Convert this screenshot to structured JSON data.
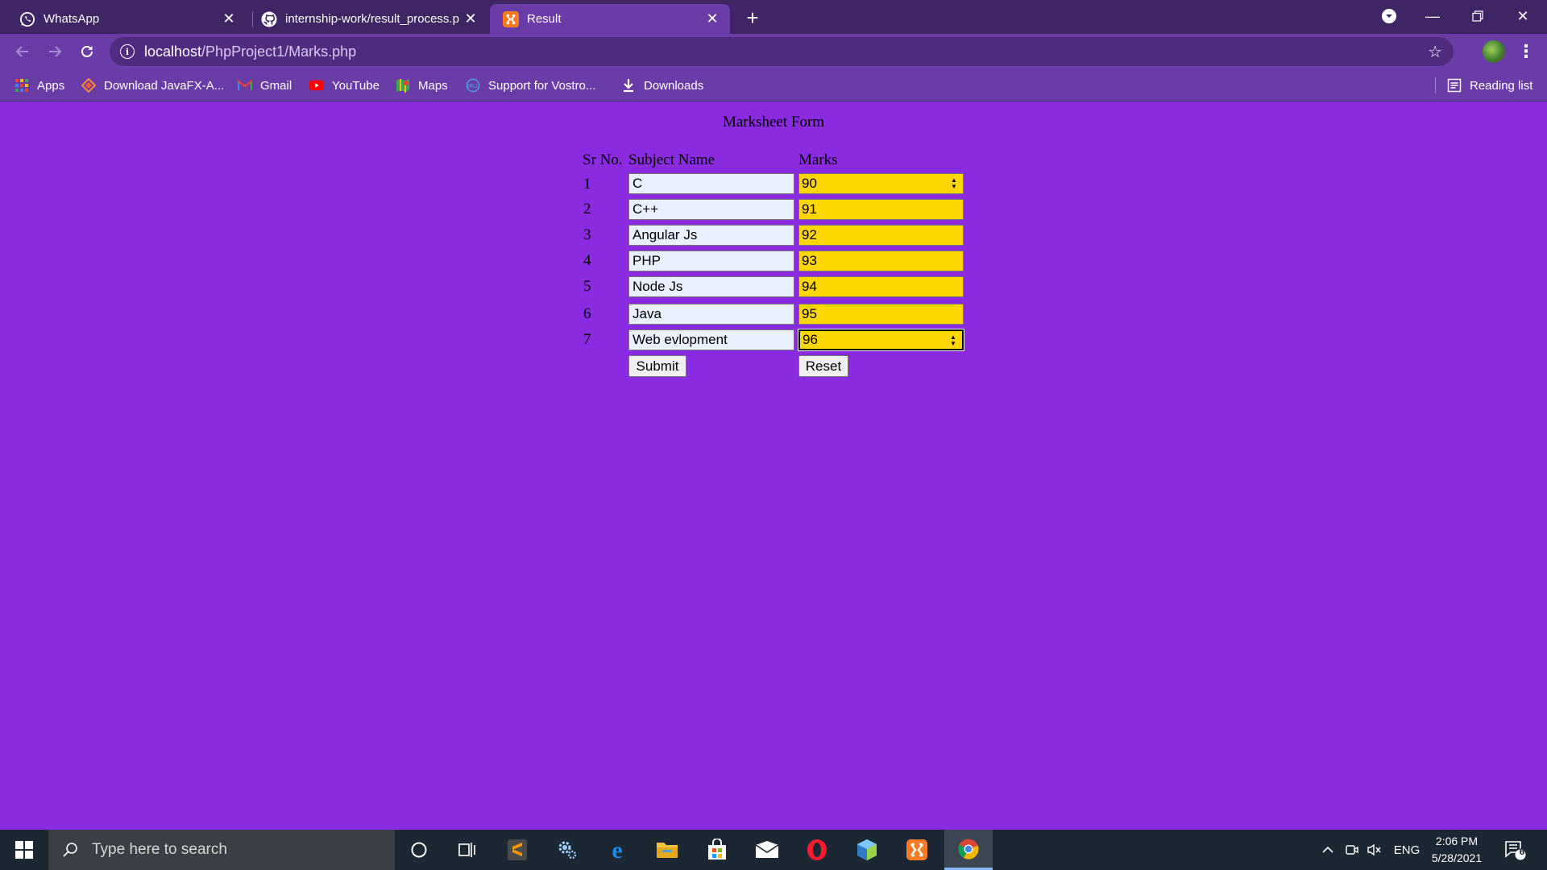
{
  "browser": {
    "tabs": [
      {
        "title": "WhatsApp",
        "icon": "whatsapp-icon"
      },
      {
        "title": "internship-work/result_process.p",
        "icon": "github-icon"
      },
      {
        "title": "Result",
        "icon": "xampp-icon"
      }
    ],
    "url_host": "localhost",
    "url_path": "/PhpProject1/Marks.php",
    "bookmarks": [
      {
        "label": "Apps",
        "icon": "apps-grid-icon"
      },
      {
        "label": "Download JavaFX-A...",
        "icon": "javafx-icon"
      },
      {
        "label": "Gmail",
        "icon": "gmail-icon"
      },
      {
        "label": "YouTube",
        "icon": "youtube-icon"
      },
      {
        "label": "Maps",
        "icon": "maps-icon"
      },
      {
        "label": "Support for Vostro...",
        "icon": "dell-icon"
      },
      {
        "label": "Downloads",
        "icon": "download-icon"
      }
    ],
    "reading_list": "Reading list"
  },
  "form": {
    "title": "Marksheet Form",
    "headers": {
      "srno": "Sr No.",
      "subject": "Subject Name",
      "marks": "Marks"
    },
    "rows": [
      {
        "no": "1",
        "subject": "C",
        "marks": "90"
      },
      {
        "no": "2",
        "subject": "C++",
        "marks": "91"
      },
      {
        "no": "3",
        "subject": "Angular Js",
        "marks": "92"
      },
      {
        "no": "4",
        "subject": "PHP",
        "marks": "93"
      },
      {
        "no": "5",
        "subject": "Node Js",
        "marks": "94"
      },
      {
        "no": "6",
        "subject": "Java",
        "marks": "95"
      },
      {
        "no": "7",
        "subject": "Web evlopment",
        "marks": "96"
      }
    ],
    "submit_label": "Submit",
    "reset_label": "Reset",
    "background_color": "#8a2be2",
    "marks_field_color": "#ffd700"
  },
  "taskbar": {
    "search_placeholder": "Type here to search",
    "language": "ENG",
    "time": "2:06 PM",
    "date": "5/28/2021",
    "notification_count": "6"
  }
}
